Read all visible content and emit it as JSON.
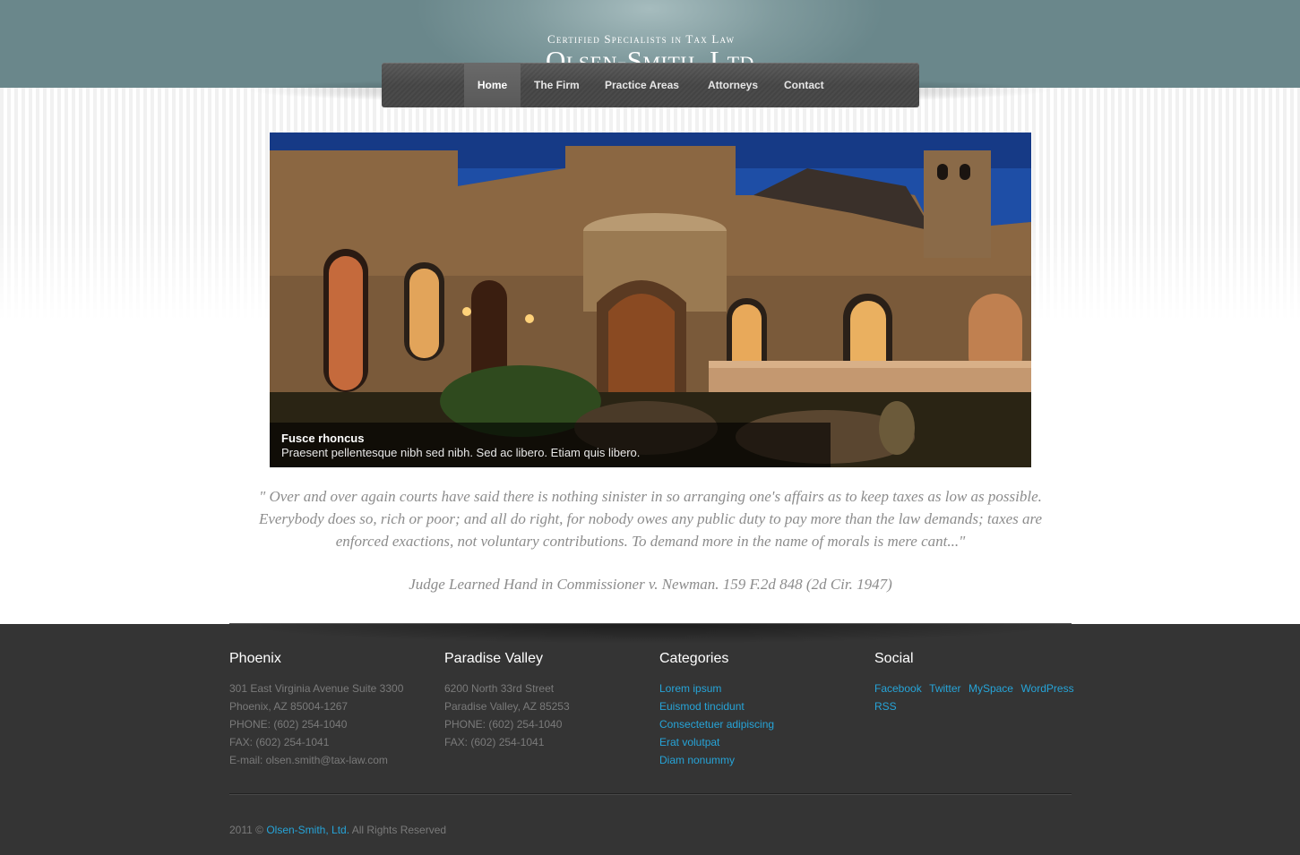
{
  "header": {
    "tagline": "Certified Specialists in Tax Law",
    "site_name": "Olsen-Smith, Ltd"
  },
  "nav": {
    "items": [
      {
        "label": "Home",
        "active": true
      },
      {
        "label": "The Firm",
        "active": false
      },
      {
        "label": "Practice Areas",
        "active": false
      },
      {
        "label": "Attorneys",
        "active": false
      },
      {
        "label": "Contact",
        "active": false
      }
    ]
  },
  "slider": {
    "caption_title": "Fusce rhoncus",
    "caption_text": "Praesent pellentesque nibh sed nibh. Sed ac libero. Etiam quis libero."
  },
  "quote": {
    "text": "\"  Over and over again courts have said there is nothing sinister in so arranging one's affairs as to keep taxes as low as possible. Everybody does so, rich or poor; and all do right, for nobody owes any public duty to pay more than the law demands; taxes are enforced exactions, not voluntary contributions. To demand more in the name of morals is mere cant...\"",
    "citation": "Judge Learned Hand in Commissioner v. Newman. 159 F.2d 848 (2d Cir. 1947)"
  },
  "footer": {
    "phoenix": {
      "heading": "Phoenix",
      "lines": [
        "301 East Virginia Avenue Suite 3300",
        "Phoenix, AZ 85004-1267",
        "PHONE: (602) 254-1040",
        "FAX: (602) 254-1041",
        "E-mail: olsen.smith@tax-law.com"
      ]
    },
    "paradise_valley": {
      "heading": "Paradise Valley",
      "lines": [
        "6200 North 33rd Street",
        "Paradise Valley, AZ 85253",
        "PHONE: (602) 254-1040",
        "FAX: (602) 254-1041"
      ]
    },
    "categories": {
      "heading": "Categories",
      "links": [
        "Lorem ipsum",
        "Euismod tincidunt",
        "Consectetuer adipiscing",
        "Erat volutpat",
        "Diam nonummy"
      ]
    },
    "social": {
      "heading": "Social",
      "links": [
        "Facebook",
        "Twitter",
        "MySpace",
        "WordPress",
        "RSS"
      ]
    },
    "copyright": {
      "prefix": "2011 ©",
      "company": "Olsen-Smith, Ltd.",
      "suffix": "All Rights Reserved"
    }
  },
  "colors": {
    "header_teal": "#6f8b8f",
    "nav_dark": "#474747",
    "footer_bg": "#343434",
    "link_blue": "#26a4d8",
    "quote_gray": "#8c8c8c"
  }
}
